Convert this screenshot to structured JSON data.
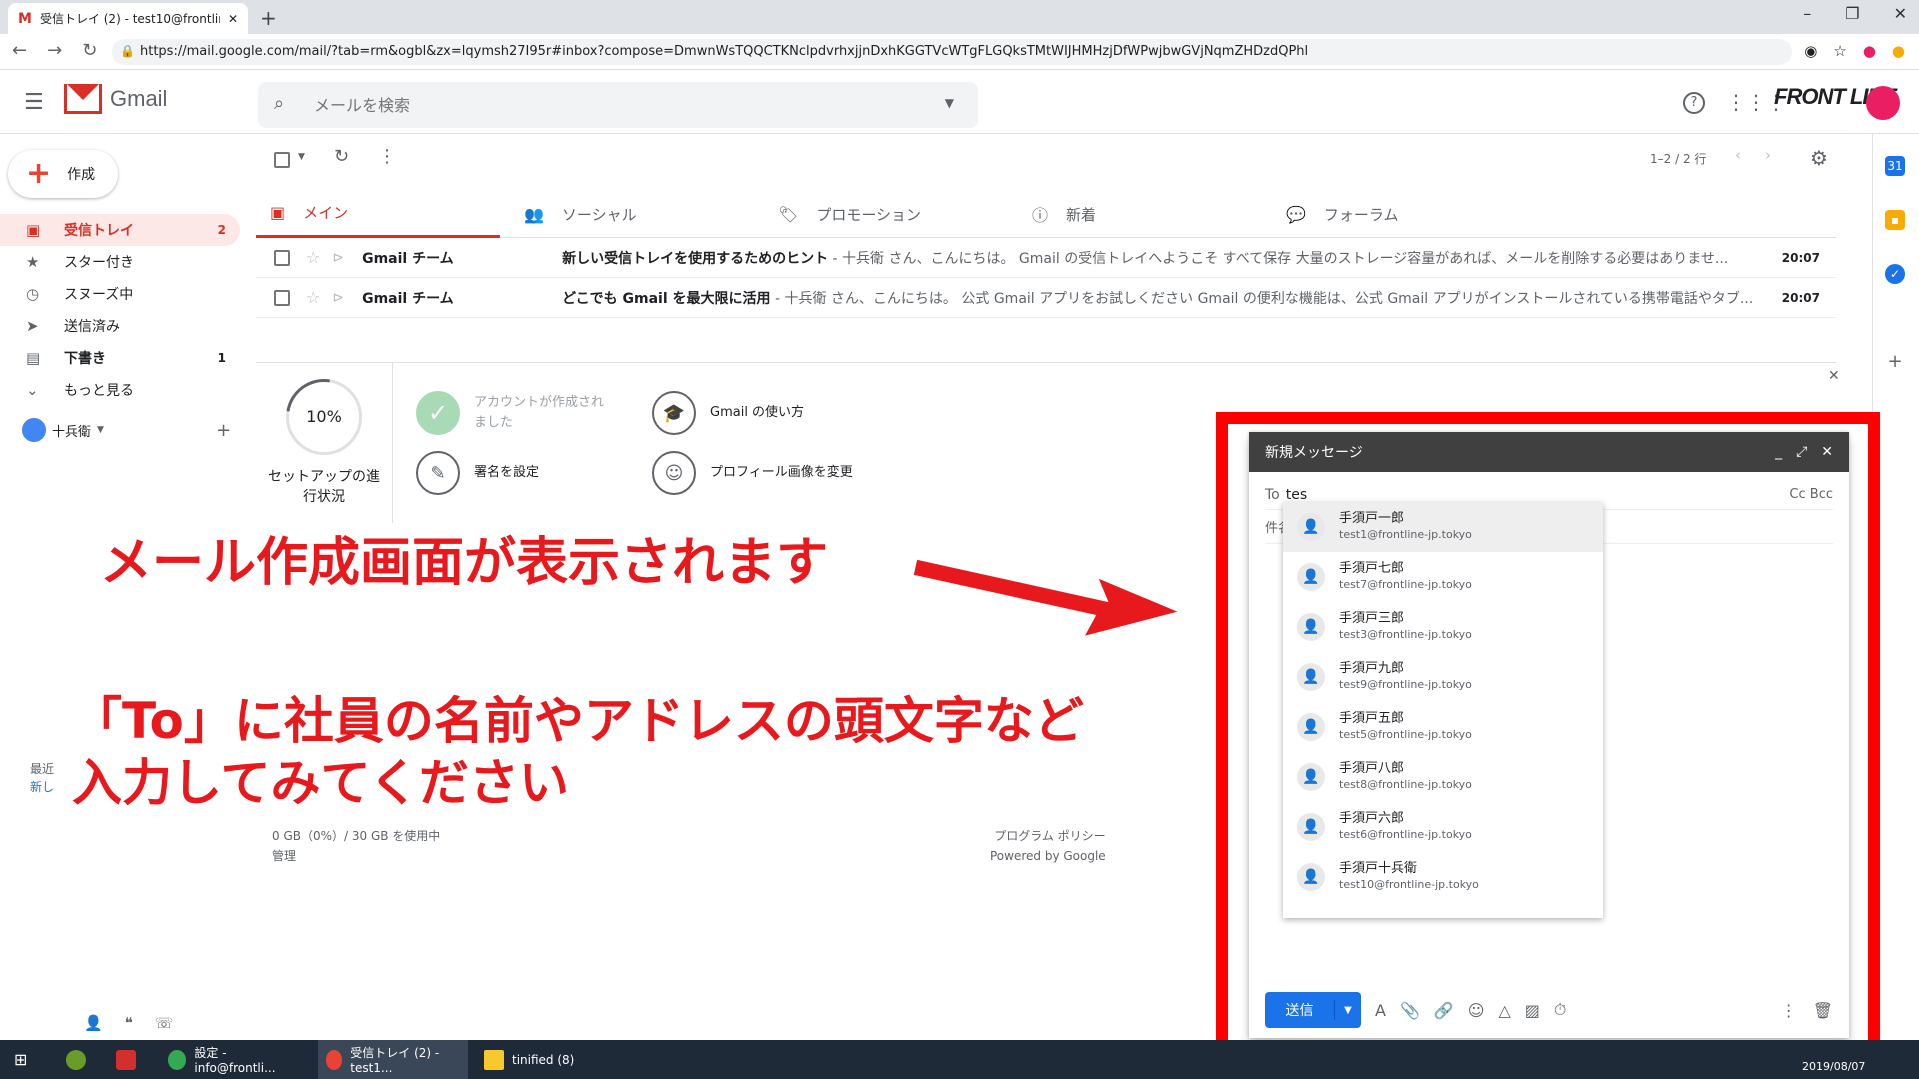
{
  "browser": {
    "tab_title": "受信トレイ (2) - test10@frontline",
    "url": "https://mail.google.com/mail/?tab=rm&ogbl&zx=lqymsh27I95r#inbox?compose=DmwnWsTQQCTKNclpdvrhxjjnDxhKGGTVcWTgFLGQksTMtWIJHMHzjDfWPwjbwGVjNqmZHDzdQPhl"
  },
  "header": {
    "app_name": "Gmail",
    "search_placeholder": "メールを検索",
    "brand": "FRONT LINE"
  },
  "compose_button": "作成",
  "sidebar": {
    "items": [
      {
        "label": "受信トレイ",
        "count": "2",
        "icon": "inbox-icon"
      },
      {
        "label": "スター付き",
        "count": "",
        "icon": "star-icon"
      },
      {
        "label": "スヌーズ中",
        "count": "",
        "icon": "clock-icon"
      },
      {
        "label": "送信済み",
        "count": "",
        "icon": "send-icon"
      },
      {
        "label": "下書き",
        "count": "1",
        "icon": "draft-icon"
      },
      {
        "label": "もっと見る",
        "count": "",
        "icon": "chevron-down-icon"
      }
    ],
    "user": "十兵衛"
  },
  "toolbar": {
    "pager": "1–2 / 2 行"
  },
  "tabs": [
    "メイン",
    "ソーシャル",
    "プロモーション",
    "新着",
    "フォーラム"
  ],
  "emails": [
    {
      "from": "Gmail チーム",
      "subject": "新しい受信トレイを使用するためのヒント",
      "snippet": " - 十兵衛 さん、こんにちは。 Gmail の受信トレイへようこそ すべて保存 大量のストレージ容量があれば、メールを削除する必要はありませ...",
      "time": "20:07"
    },
    {
      "from": "Gmail チーム",
      "subject": "どこでも Gmail を最大限に活用",
      "snippet": " - 十兵衛 さん、こんにちは。 公式 Gmail アプリをお試しください Gmail の便利な機能は、公式 Gmail アプリがインストールされている携帯電話やタブ...",
      "time": "20:07"
    }
  ],
  "setup": {
    "progress": "10%",
    "label": "セットアップの進行状況",
    "tasks": [
      {
        "text": "アカウントが作成されました",
        "done": true
      },
      {
        "text": "Gmail の使い方",
        "done": false
      },
      {
        "text": "署名を設定",
        "done": false
      },
      {
        "text": "プロフィール画像を変更",
        "done": false
      }
    ]
  },
  "footer": {
    "storage": "0 GB（0%）/ 30 GB を使用中",
    "manage": "管理",
    "policy": "プログラム ポリシー",
    "powered": "Powered by Google"
  },
  "ghost": {
    "line1": "最近",
    "line2": "新し"
  },
  "compose": {
    "title": "新規メッセージ",
    "to_label": "To",
    "to_value": "tes",
    "cc_bcc": "Cc Bcc",
    "subject_label": "件名",
    "send_label": "送信",
    "suggestions": [
      {
        "name": "手須戸一郎",
        "email": "test1@frontline-jp.tokyo"
      },
      {
        "name": "手須戸七郎",
        "email": "test7@frontline-jp.tokyo"
      },
      {
        "name": "手須戸三郎",
        "email": "test3@frontline-jp.tokyo"
      },
      {
        "name": "手須戸九郎",
        "email": "test9@frontline-jp.tokyo"
      },
      {
        "name": "手須戸五郎",
        "email": "test5@frontline-jp.tokyo"
      },
      {
        "name": "手須戸八郎",
        "email": "test8@frontline-jp.tokyo"
      },
      {
        "name": "手須戸六郎",
        "email": "test6@frontline-jp.tokyo"
      },
      {
        "name": "手須戸十兵衛",
        "email": "test10@frontline-jp.tokyo"
      }
    ]
  },
  "annotation": {
    "line1": "メール作成画面が表示されます",
    "line2": "「To」に社員の名前やアドレスの頭文字など",
    "line3": "入力してみてください",
    "color": "#e8191d"
  },
  "taskbar": {
    "items": [
      "設定 - info@frontli...",
      "受信トレイ (2) - test1...",
      "tinified (8)"
    ],
    "date": "2019/08/07"
  }
}
